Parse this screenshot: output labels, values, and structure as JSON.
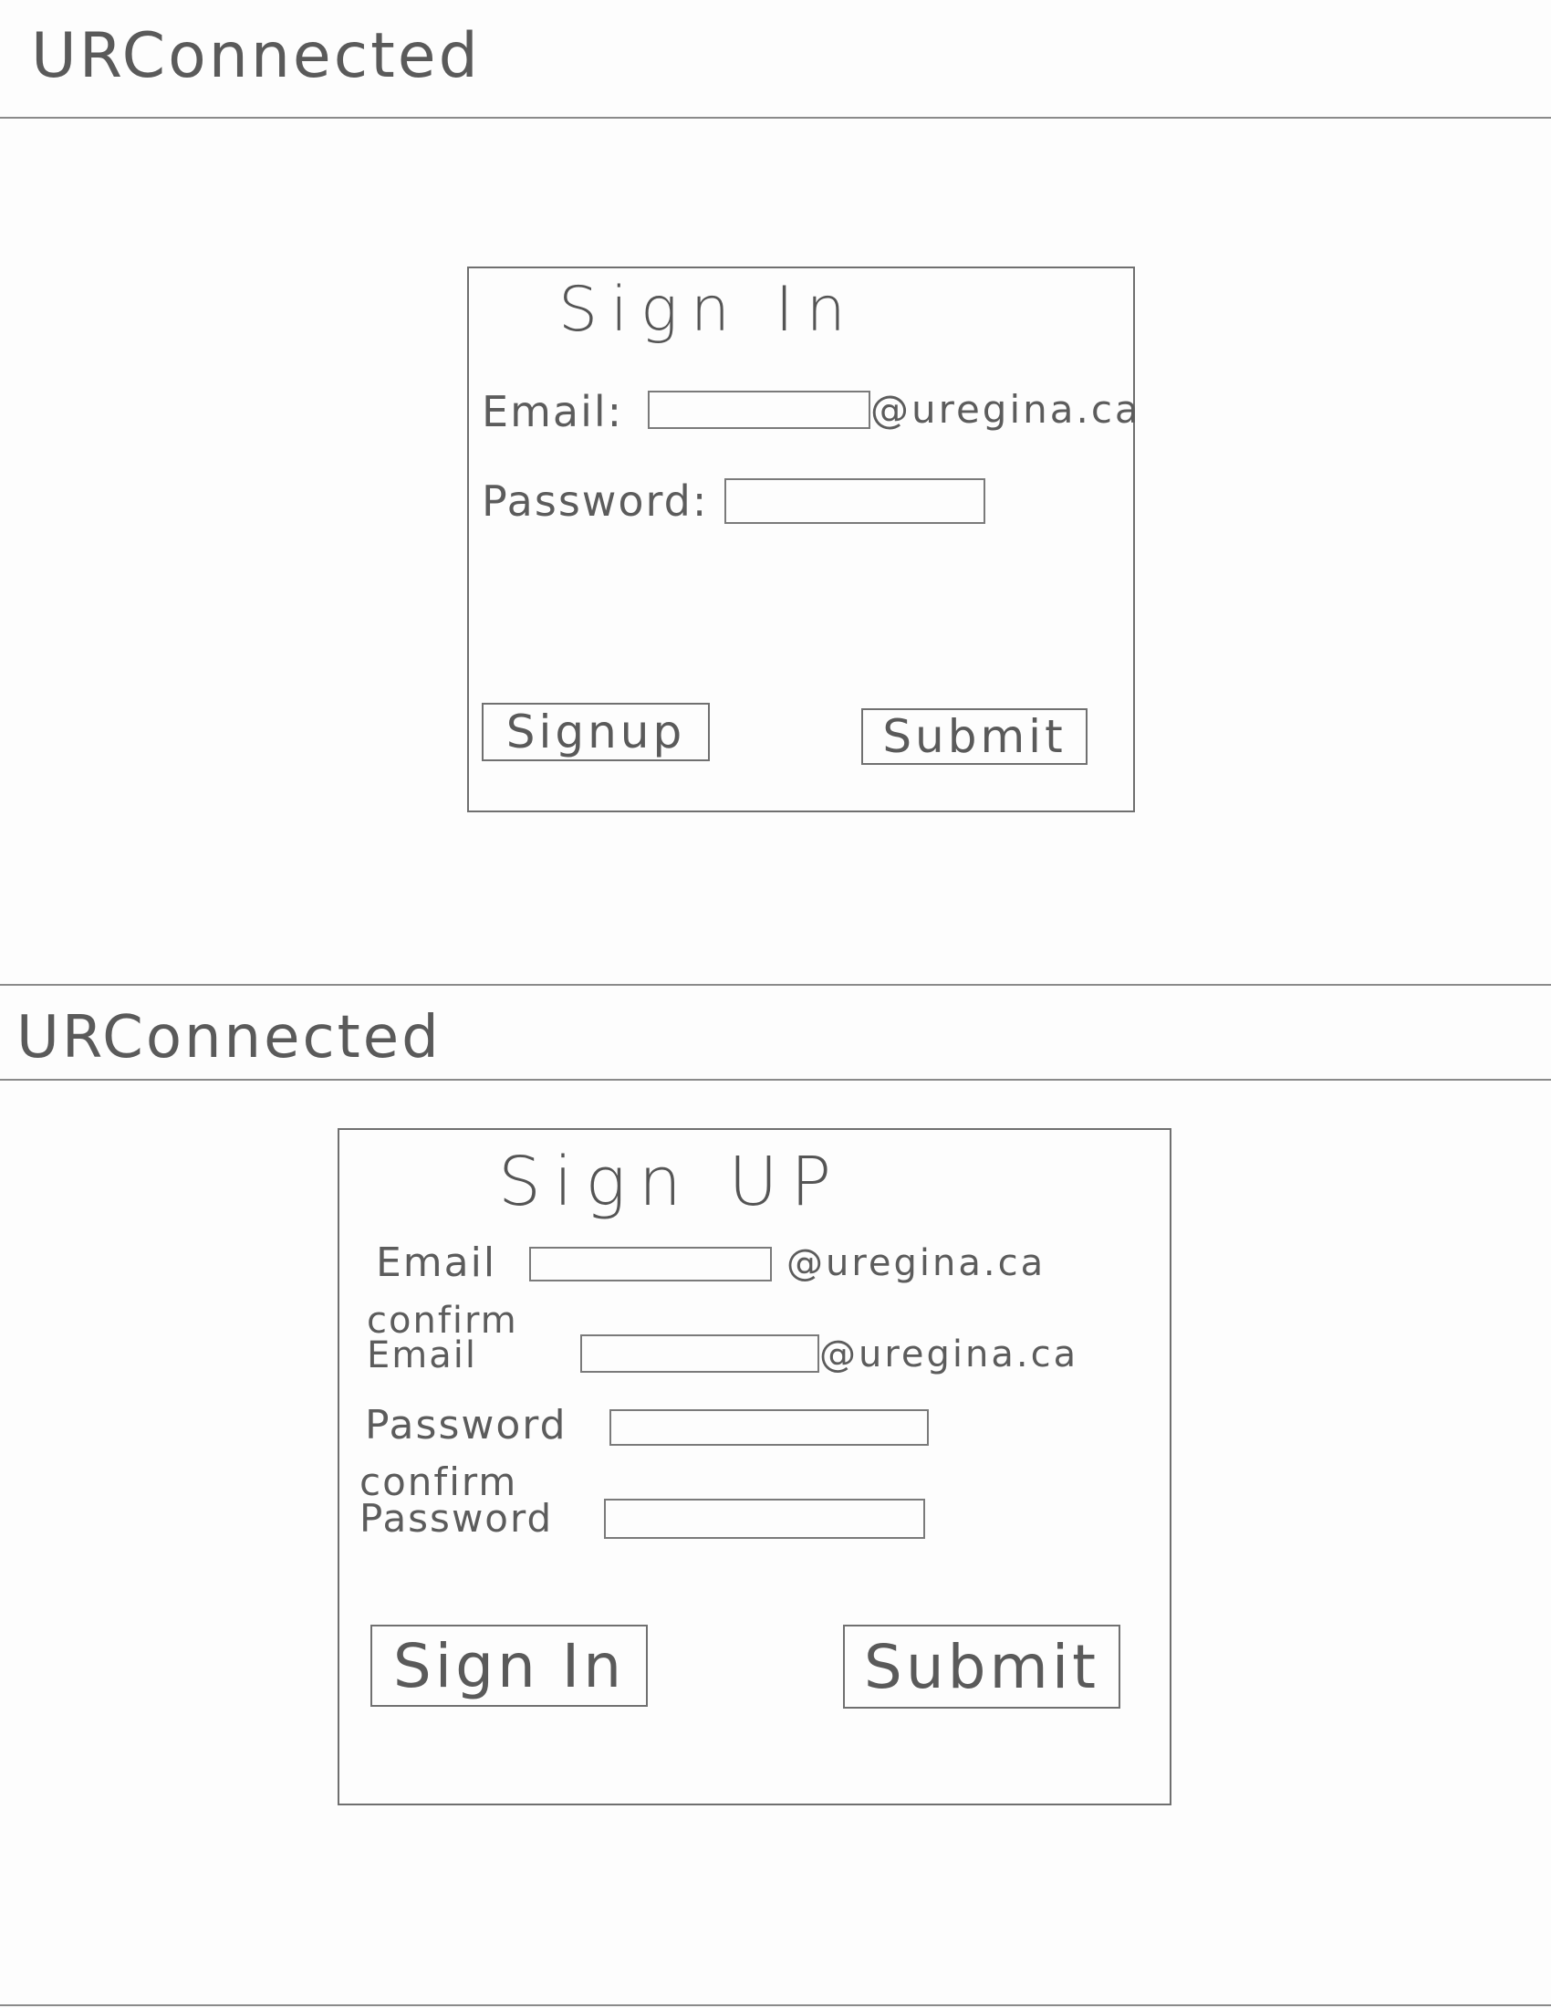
{
  "app": {
    "title": "URConnected"
  },
  "sign_in": {
    "title": "Sign In",
    "email_label": "Email:",
    "email_value": "",
    "email_suffix": "@uregina.ca",
    "password_label": "Password:",
    "password_value": "",
    "signup_button": "Signup",
    "submit_button": "Submit"
  },
  "sign_up": {
    "title": "Sign UP",
    "email_label": "Email",
    "email_value": "",
    "email_suffix": "@uregina.ca",
    "confirm_email_label_1": "confirm",
    "confirm_email_label_2": "Email",
    "confirm_email_value": "",
    "confirm_email_suffix": "@uregina.ca",
    "password_label": "Password",
    "password_value": "",
    "confirm_password_label_1": "confirm",
    "confirm_password_label_2": "Password",
    "confirm_password_value": "",
    "signin_button": "Sign In",
    "submit_button": "Submit"
  }
}
